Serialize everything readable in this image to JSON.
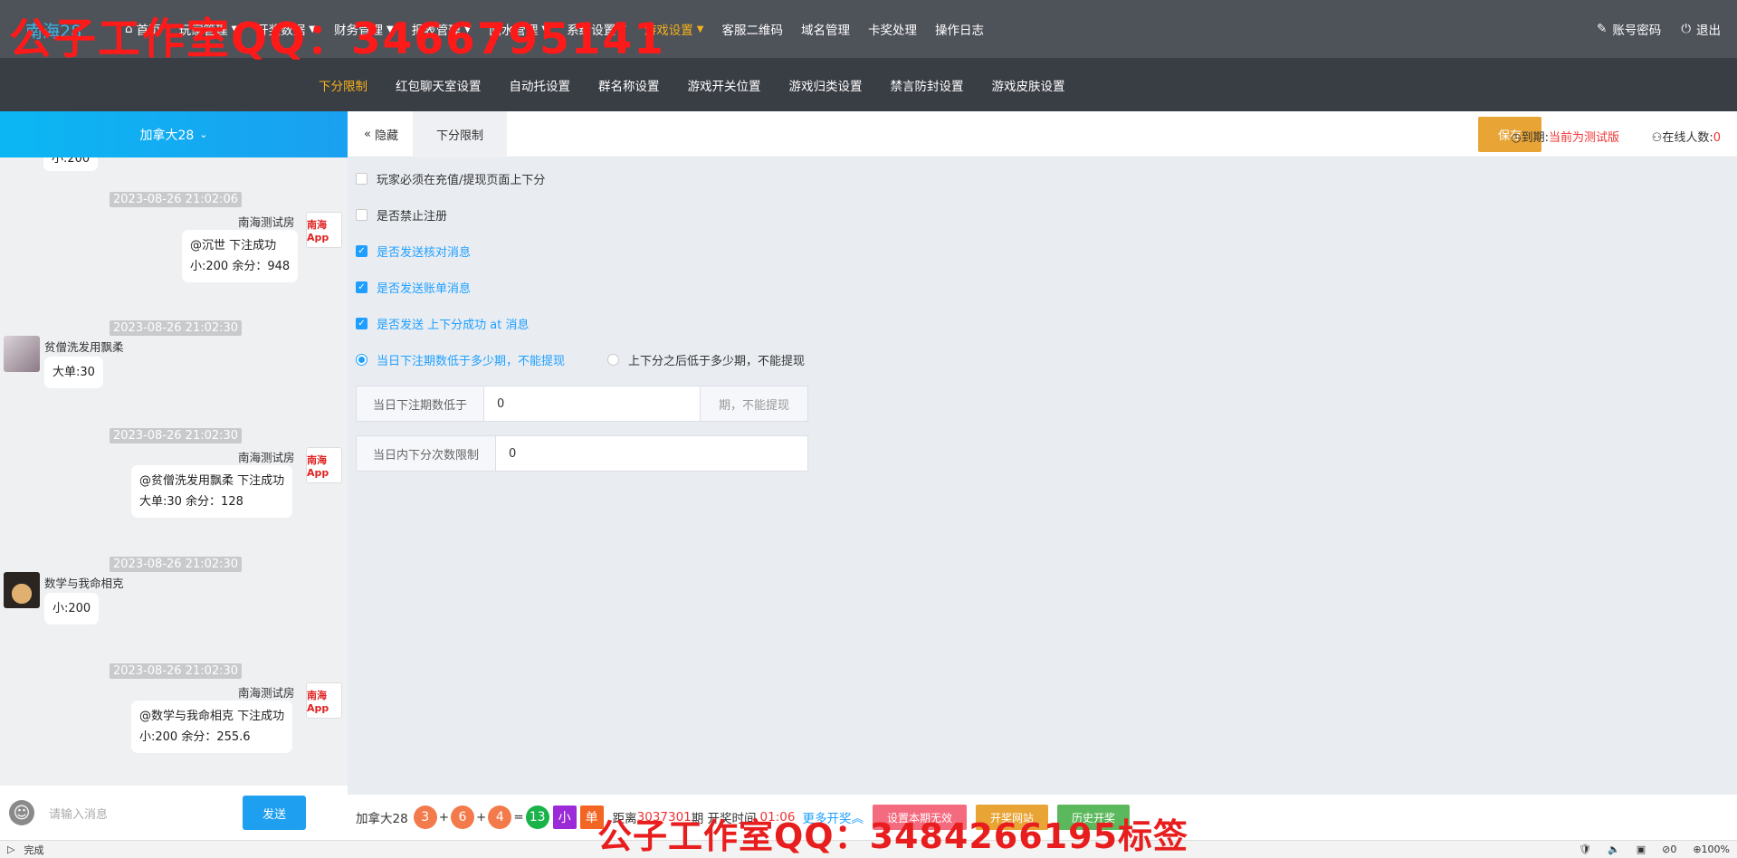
{
  "brand": "南海28",
  "watermark_top": "公子工作室QQ：3466795141",
  "watermark_bottom": "公子工作室QQ：3484266195标签",
  "nav": [
    {
      "label": "首页",
      "icon": "home-icon"
    },
    {
      "label": "玩家管理",
      "caret": true
    },
    {
      "label": "开奖数据",
      "caret": true
    },
    {
      "label": "财务管理",
      "caret": true
    },
    {
      "label": "报表管理",
      "caret": true
    },
    {
      "label": "回水管理",
      "caret": true
    },
    {
      "label": "系统设置",
      "caret": true
    },
    {
      "label": "游戏设置",
      "caret": true,
      "active": true
    },
    {
      "label": "客服二维码"
    },
    {
      "label": "域名管理"
    },
    {
      "label": "卡奖处理"
    },
    {
      "label": "操作日志"
    }
  ],
  "top_right": {
    "account": "账号密码",
    "logout": "退出"
  },
  "subnav": [
    "下分限制",
    "红包聊天室设置",
    "自动托设置",
    "群名称设置",
    "游戏开关位置",
    "游戏归类设置",
    "禁言防封设置",
    "游戏皮肤设置"
  ],
  "subnav_active": 0,
  "chat": {
    "room": "加拿大28",
    "partial_top": "小:200",
    "messages": [
      {
        "time": "2023-08-26 21:02:06",
        "sender": "南海测试房",
        "line1": "@沉世 下注成功",
        "line2": "小:200 余分：948",
        "side": "right"
      },
      {
        "time": "2023-08-26 21:02:30",
        "sender": "贫僧洗发用飘柔",
        "line1": "大单:30",
        "side": "left"
      },
      {
        "time": "2023-08-26 21:02:30",
        "sender": "南海测试房",
        "line1": "@贫僧洗发用飘柔 下注成功",
        "line2": "大单:30 余分：128",
        "side": "right"
      },
      {
        "time": "2023-08-26 21:02:30",
        "sender": "数学与我命相克",
        "line1": "小:200",
        "side": "left"
      },
      {
        "time": "2023-08-26 21:02:30",
        "sender": "南海测试房",
        "line1": "@数学与我命相克 下注成功",
        "line2": "小:200 余分：255.6",
        "side": "right"
      }
    ],
    "app_avatar_text": "南海App",
    "input_placeholder": "请输入消息",
    "send_label": "发送"
  },
  "tabs": {
    "hide_label": "隐藏",
    "active_tab": "下分限制"
  },
  "header_right": {
    "save_label": "保存",
    "expire_label": "到期:",
    "expire_value": "当前为测试版",
    "online_label": "在线人数:",
    "online_value": "0"
  },
  "options": [
    {
      "label": "玩家必须在充值/提现页面上下分",
      "checked": false
    },
    {
      "label": "是否禁止注册",
      "checked": false
    },
    {
      "label": "是否发送核对消息",
      "checked": true
    },
    {
      "label": "是否发送账单消息",
      "checked": true
    },
    {
      "label": "是否发送 上下分成功 at 消息",
      "checked": true
    }
  ],
  "radios": [
    {
      "label": "当日下注期数低于多少期，不能提现",
      "selected": true
    },
    {
      "label": "上下分之后低于多少期，不能提现",
      "selected": false
    }
  ],
  "field1": {
    "label": "当日下注期数低于",
    "value": "0",
    "suffix": "期，不能提现"
  },
  "field2": {
    "label": "当日内下分次数限制",
    "value": "0"
  },
  "lottery": {
    "game": "加拿大28",
    "n1": "3",
    "plus1": "+",
    "n2": "6",
    "plus2": "+",
    "n3": "4",
    "eq": "=",
    "sum": "13",
    "tag1": "小",
    "tag2": "单",
    "distance_label": "距离",
    "period": "3037301",
    "period_suffix": "期 开奖时间",
    "countdown": "01:06",
    "more": "更多开奖",
    "btn_invalid": "设置本期无效",
    "btn_site": "开奖网站",
    "btn_history": "历史开奖"
  },
  "status": {
    "text": "完成",
    "badge": "0",
    "zoom": "100%"
  }
}
